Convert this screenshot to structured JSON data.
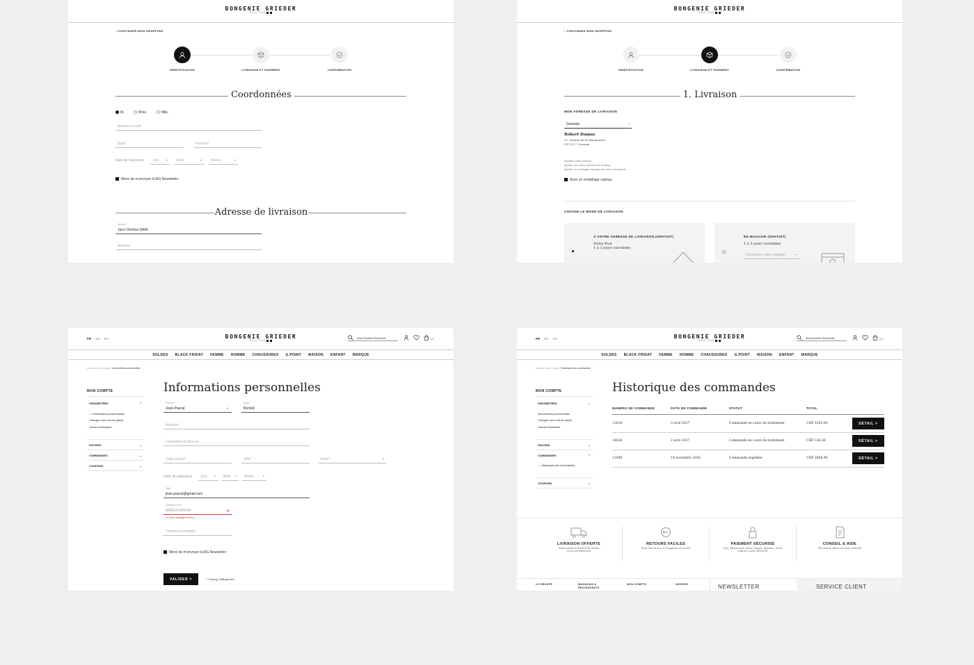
{
  "brand": {
    "name": "BONGENIE GRIEDER",
    "sub": "Since 1905"
  },
  "checkout": {
    "continue_shopping": "CONTINUER MON SHOPPING",
    "steps": [
      {
        "label": "IDENTIFICATION",
        "icon": "user-icon"
      },
      {
        "label": "LIVRAISON ET PAIEMENT",
        "icon": "package-icon"
      },
      {
        "label": "CONFIRMATION",
        "icon": "check-circle-icon"
      }
    ]
  },
  "panel1": {
    "section1_title": "Coordonnées",
    "civility": [
      "M.",
      "Mme.",
      "Mlle."
    ],
    "civility_selected": 0,
    "email_ph": "Adresse e-mail*",
    "lastname_ph": "Nom*",
    "firstname_ph": "Prénom*",
    "birth_label": "Date de naissance",
    "day_ph": "Jour",
    "month_ph": "Mois",
    "year_ph": "Année",
    "newsletter": "Merci de m'envoyer la BG Newsletter",
    "section2_title": "Adresse de livraison",
    "company_label": "Société",
    "company_val": "Jaco Chichou SARL",
    "address_ph": "Adresse"
  },
  "panel2": {
    "section_title": "1. Livraison",
    "address_heading": "MON ADRESSE DE LIVRAISON",
    "address_select": "Domicile",
    "name": "Robert Dumas",
    "street": "21, chemin de la Machenette",
    "city": "CH 1227 Carouge",
    "links": [
      "Modifier cette adresse",
      "Ajouter une autre adresse de livraison",
      "Ajouter un message à propos de votre commande"
    ],
    "gift": "Avoir un emballage cadeau",
    "mode_heading": "CHOISIR LE MODE DE LIVRAISON",
    "option1_title": "À VOTRE ADRESSE DE LIVRAISON (GRATUIT)",
    "option1_l1": "Swiss Post",
    "option1_l2": "1 à 3 jours ouvrables",
    "option2_title": "EN MAGASIN (GRATUIT)",
    "option2_l1": "1 à 2 jours ouvrables",
    "option2_select": "Choisissez votre magasin"
  },
  "header": {
    "langs": [
      "FR",
      "DE",
      "EN"
    ],
    "search_val": "Jean Dorothee Shumacher",
    "cart_count": "(0)",
    "nav": [
      "SOLDES",
      "BLACK FRIDAY",
      "FEMME",
      "HOMME",
      "CHAUSSURES",
      "G.POINT",
      "MAISON",
      "ENFANT",
      "MARQUE"
    ]
  },
  "panel3": {
    "breadcrumb": [
      "Accueil",
      "Mon compte",
      "Informations personnelles"
    ],
    "side_title": "MON COMPTE",
    "param": "PARAMÈTRES",
    "sub": [
      "Informations personnelles",
      "Changer mon mot de passe",
      "Carnet d'adresses"
    ],
    "groups": [
      "FAVORIS",
      "COMMANDES",
      "COUPONS"
    ],
    "title": "Informations personnelles",
    "firstname_label": "Prénom*",
    "firstname_val": "Jean-Pascal",
    "lastname_label": "Nom*",
    "lastname_val": "Bonbid",
    "address_ph": "Adresse*",
    "address2_ph": "Complément adresse",
    "zip_ph": "Code postal*",
    "city_ph": "Ville*",
    "country_ph": "Pays*",
    "birth_label": "Date de naissance",
    "day_ph": "Jour",
    "month_ph": "Mois",
    "year_ph": "Année",
    "email_label": "Mail*",
    "email_val": "jean-pascal@gmail.com",
    "phone_label": "Téléphone fixe",
    "phone_val": "8045141451544",
    "phone_err": "Ici, texte message d'erreur",
    "mobile_ph": "Téléphone portable",
    "newsletter": "Merci de m'envoyer la BG Newsletter",
    "submit": "VALIDER >",
    "required": "* Champ obligatoire"
  },
  "panel4": {
    "breadcrumb": [
      "Accueil",
      "Mon compte",
      "Historique des commandes"
    ],
    "side_title": "MON COMPTE",
    "param": "PARAMÈTRES",
    "sub": [
      "Informations personnelles",
      "Changer mon mot de passe",
      "Carnet d'adresses"
    ],
    "favoris": "FAVORIS",
    "commandes": "COMMANDES",
    "commandes_sub": "Historique des commandes",
    "coupons": "COUPONS",
    "title": "Historique des commandes",
    "columns": [
      "NUMÉRO DE COMMANDE",
      "DATE DE COMMANDE",
      "STATUT",
      "TOTAL"
    ],
    "rows": [
      {
        "num": "13016",
        "date": "3 avril 2017",
        "status": "Commande en cours de traitement",
        "total": "CHF 2205,00",
        "btn": "DÉTAIL >"
      },
      {
        "num": "14026",
        "date": "2 avril 2017",
        "status": "Commande en cours de traitement",
        "total": "CHF 236,20",
        "btn": "DÉTAIL >"
      },
      {
        "num": "11089",
        "date": "14 novembre 2016",
        "status": "Commande expédiée",
        "total": "CHF 2856,90",
        "btn": "DÉTAIL >"
      }
    ],
    "features": [
      {
        "title": "LIVRAISON OFFERTE",
        "desc": "Sans minimum d'achat En Suisse et au Liechtenstein",
        "icon": "truck-icon"
      },
      {
        "title": "RETOURS FACILES",
        "desc": "Dans l'un de nos 33 magasins en Suisse",
        "icon": "return-icon"
      },
      {
        "title": "PAIEMENT SÉCURISÉ",
        "desc": "Visa, Mastercard, Amex, Paypal, Maestro, Carte Cadeau, Carte client BG",
        "icon": "lock-icon"
      },
      {
        "title": "CONSEIL & AIDE",
        "desc": "Vos achats online en toute sérénité",
        "icon": "document-icon"
      }
    ],
    "footer_links": [
      "LE GROUPE",
      "MAGASINS & RESTAURANTS",
      "MON COMPTE",
      "UNIVERS"
    ],
    "newsletter": "NEWSLETTER",
    "service": "SERVICE CLIENT"
  }
}
